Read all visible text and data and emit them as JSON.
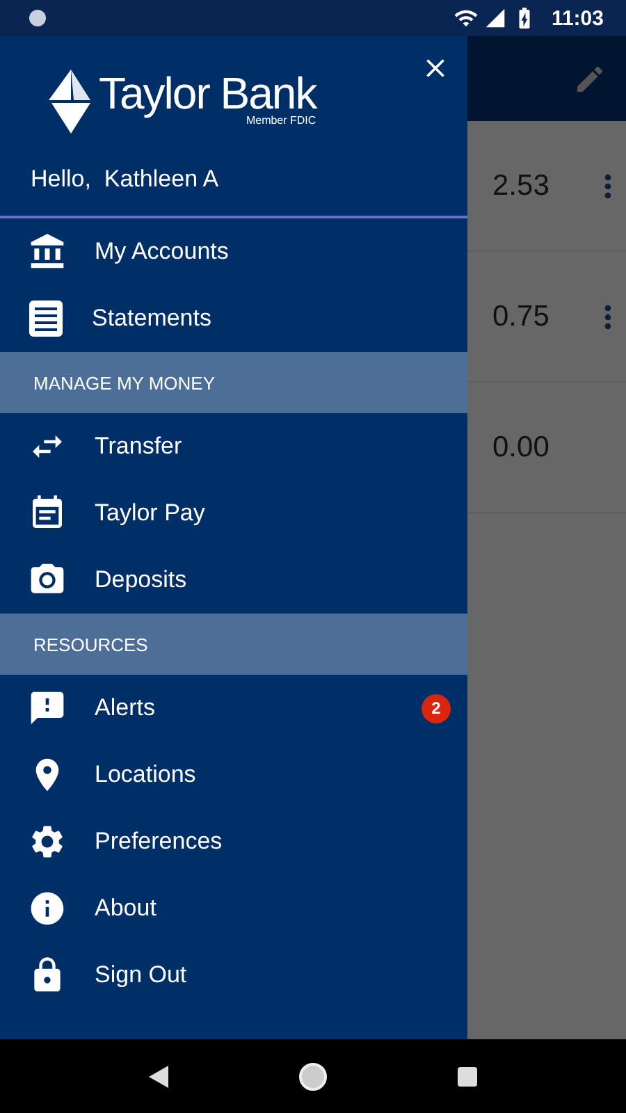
{
  "status_bar": {
    "time": "11:03"
  },
  "background": {
    "rows": [
      {
        "amount": "2.53",
        "more": true
      },
      {
        "amount": "0.75",
        "more": true
      },
      {
        "amount": "0.00",
        "more": false
      }
    ]
  },
  "drawer": {
    "logo": {
      "name": "Taylor Bank",
      "tagline": "Member FDIC"
    },
    "greeting": "Hello,  Kathleen A",
    "menu": [
      {
        "kind": "item",
        "label": "My Accounts"
      },
      {
        "kind": "item",
        "label": "Statements"
      },
      {
        "kind": "section",
        "label": "MANAGE MY MONEY"
      },
      {
        "kind": "item",
        "label": "Transfer"
      },
      {
        "kind": "item",
        "label": "Taylor Pay"
      },
      {
        "kind": "item",
        "label": "Deposits"
      },
      {
        "kind": "section",
        "label": "RESOURCES"
      },
      {
        "kind": "item",
        "label": "Alerts",
        "badge": "2"
      },
      {
        "kind": "item",
        "label": "Locations"
      },
      {
        "kind": "item",
        "label": "Preferences"
      },
      {
        "kind": "item",
        "label": "About"
      },
      {
        "kind": "item",
        "label": "Sign Out"
      }
    ]
  }
}
